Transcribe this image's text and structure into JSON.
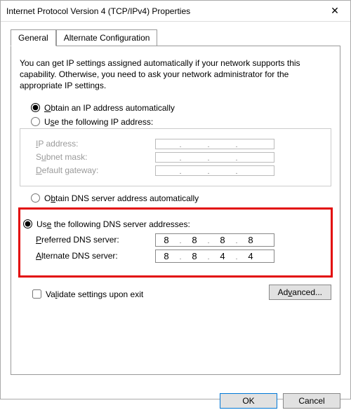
{
  "window": {
    "title": "Internet Protocol Version 4 (TCP/IPv4) Properties",
    "close_glyph": "✕"
  },
  "tabs": {
    "general": "General",
    "alt": "Alternate Configuration"
  },
  "description": "You can get IP settings assigned automatically if your network supports this capability. Otherwise, you need to ask your network administrator for the appropriate IP settings.",
  "ip": {
    "radio_auto": "Obtain an IP address automatically",
    "radio_manual": "Use the following IP address:",
    "field_ip": "IP address:",
    "field_mask": "Subnet mask:",
    "field_gw": "Default gateway:"
  },
  "dns": {
    "radio_auto": "Obtain DNS server address automatically",
    "radio_manual": "Use the following DNS server addresses:",
    "field_pref": "Preferred DNS server:",
    "field_alt": "Alternate DNS server:",
    "pref": {
      "o1": "8",
      "o2": "8",
      "o3": "8",
      "o4": "8"
    },
    "alt": {
      "o1": "8",
      "o2": "8",
      "o3": "4",
      "o4": "4"
    }
  },
  "validate": "Validate settings upon exit",
  "advanced": "Advanced...",
  "ok": "OK",
  "cancel": "Cancel",
  "dot": "."
}
